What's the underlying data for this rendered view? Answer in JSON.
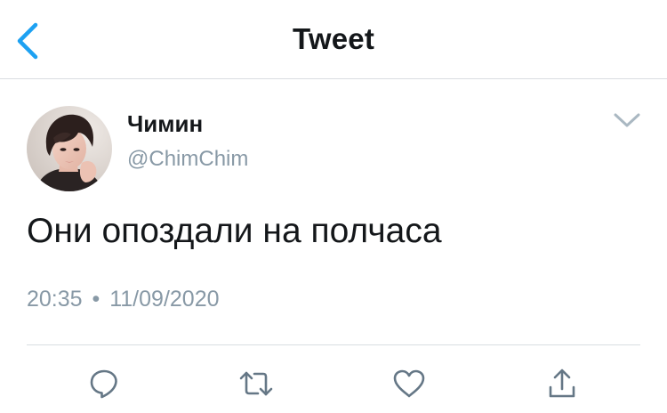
{
  "header": {
    "title": "Tweet",
    "back_icon": "chevron-left-icon",
    "accent_color": "#1da1f2"
  },
  "tweet": {
    "author": {
      "display_name": "Чимин",
      "username": "@ChimChim",
      "avatar_icon": "profile-photo"
    },
    "text": "Они опоздали на полчаса",
    "time": "20:35",
    "separator": "•",
    "date": "11/09/2020",
    "more_icon": "chevron-down-icon"
  },
  "actions": [
    {
      "name": "reply",
      "icon": "reply-icon"
    },
    {
      "name": "retweet",
      "icon": "retweet-icon"
    },
    {
      "name": "like",
      "icon": "heart-icon"
    },
    {
      "name": "share",
      "icon": "share-icon"
    }
  ],
  "colors": {
    "text": "#14171a",
    "secondary_text": "#8899a6",
    "divider": "#d9dde1",
    "icon": "#657786"
  }
}
